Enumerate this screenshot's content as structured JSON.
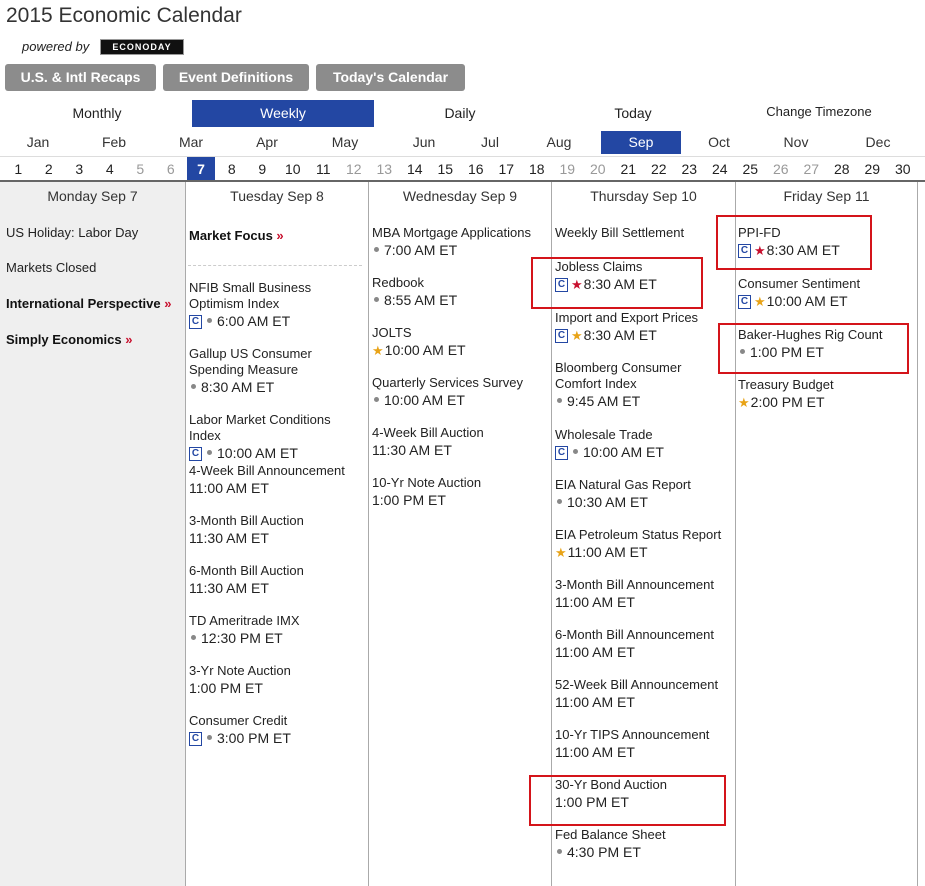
{
  "header": {
    "title": "2015 Economic Calendar",
    "powered_by": "powered by",
    "logo_text": "ECONODAY"
  },
  "top_buttons": [
    "U.S. & Intl Recaps",
    "Event Definitions",
    "Today's Calendar"
  ],
  "view_tabs": [
    {
      "label": "Monthly",
      "active": false
    },
    {
      "label": "Weekly",
      "active": true
    },
    {
      "label": "Daily",
      "active": false
    },
    {
      "label": "Today",
      "active": false
    },
    {
      "label": "Change Timezone",
      "active": false
    }
  ],
  "months": [
    "Jan",
    "Feb",
    "Mar",
    "Apr",
    "May",
    "Jun",
    "Jul",
    "Aug",
    "Sep",
    "Oct",
    "Nov",
    "Dec"
  ],
  "active_month": "Sep",
  "days": [
    "1",
    "2",
    "3",
    "4",
    "5",
    "6",
    "7",
    "8",
    "9",
    "10",
    "11",
    "12",
    "13",
    "14",
    "15",
    "16",
    "17",
    "18",
    "19",
    "20",
    "21",
    "22",
    "23",
    "24",
    "25",
    "26",
    "27",
    "28",
    "29",
    "30"
  ],
  "weekend_days": [
    "5",
    "6",
    "12",
    "13",
    "19",
    "20",
    "26",
    "27"
  ],
  "active_day": "7",
  "colors": {
    "accent": "#2347a3",
    "button_gray": "#8c8c8c",
    "highlight_red": "#d4141a",
    "star_red": "#c8102e",
    "star_gold": "#e8a317"
  },
  "columns": [
    {
      "header": "Monday Sep 7",
      "items": [
        {
          "name": "US Holiday: Labor Day"
        },
        {
          "name": "Markets Closed"
        },
        {
          "name": "International Perspective",
          "link": true
        },
        {
          "name": "Simply Economics",
          "link": true
        }
      ]
    },
    {
      "header": "Tuesday Sep 8",
      "items": [
        {
          "name": "Market Focus",
          "link": true
        },
        {
          "name": "NFIB Small Business Optimism Index",
          "time": "6:00 AM ET",
          "icon": "c-dot"
        },
        {
          "name": "Gallup US Consumer Spending Measure",
          "time": "8:30 AM ET",
          "icon": "dot"
        },
        {
          "name": "Labor Market Conditions Index",
          "time": "10:00 AM ET",
          "icon": "c-dot"
        },
        {
          "name": "4-Week Bill Announcement",
          "time": "11:00 AM ET"
        },
        {
          "name": "3-Month Bill Auction",
          "time": "11:30 AM ET"
        },
        {
          "name": "6-Month Bill Auction",
          "time": "11:30 AM ET"
        },
        {
          "name": "TD Ameritrade IMX",
          "time": "12:30 PM ET",
          "icon": "dot"
        },
        {
          "name": "3-Yr Note Auction",
          "time": "1:00 PM ET"
        },
        {
          "name": "Consumer Credit",
          "time": "3:00 PM ET",
          "icon": "c-dot"
        }
      ]
    },
    {
      "header": "Wednesday Sep 9",
      "items": [
        {
          "name": "MBA Mortgage Applications",
          "time": "7:00 AM ET",
          "icon": "dot"
        },
        {
          "name": "Redbook",
          "time": "8:55 AM ET",
          "icon": "dot"
        },
        {
          "name": "JOLTS",
          "time": "10:00 AM ET",
          "icon": "gold-star"
        },
        {
          "name": "Quarterly Services Survey",
          "time": "10:00 AM ET",
          "icon": "dot"
        },
        {
          "name": "4-Week Bill Auction",
          "time": "11:30 AM ET"
        },
        {
          "name": "10-Yr Note Auction",
          "time": "1:00 PM ET"
        }
      ]
    },
    {
      "header": "Thursday Sep 10",
      "items": [
        {
          "name": "Weekly Bill Settlement"
        },
        {
          "name": "Jobless Claims",
          "time": "8:30 AM ET",
          "icon": "c-red-star"
        },
        {
          "name": "Import and Export Prices",
          "time": "8:30 AM ET",
          "icon": "c-gold-star"
        },
        {
          "name": "Bloomberg Consumer Comfort Index",
          "time": "9:45 AM ET",
          "icon": "dot"
        },
        {
          "name": "Wholesale Trade",
          "time": "10:00 AM ET",
          "icon": "c-dot"
        },
        {
          "name": "EIA Natural Gas Report",
          "time": "10:30 AM ET",
          "icon": "dot"
        },
        {
          "name": "EIA Petroleum Status Report",
          "time": "11:00 AM ET",
          "icon": "gold-star"
        },
        {
          "name": "3-Month Bill Announcement",
          "time": "11:00 AM ET"
        },
        {
          "name": "6-Month Bill Announcement",
          "time": "11:00 AM ET"
        },
        {
          "name": "52-Week Bill Announcement",
          "time": "11:00 AM ET"
        },
        {
          "name": "10-Yr TIPS Announcement",
          "time": "11:00 AM ET"
        },
        {
          "name": "30-Yr Bond Auction",
          "time": "1:00 PM ET"
        },
        {
          "name": "Fed Balance Sheet",
          "time": "4:30 PM ET",
          "icon": "dot"
        }
      ]
    },
    {
      "header": "Friday Sep 11",
      "items": [
        {
          "name": "PPI-FD",
          "time": "8:30 AM ET",
          "icon": "c-red-star"
        },
        {
          "name": "Consumer Sentiment",
          "time": "10:00 AM ET",
          "icon": "c-gold-star"
        },
        {
          "name": "Baker-Hughes Rig Count",
          "time": "1:00 PM ET",
          "icon": "dot"
        },
        {
          "name": "Treasury Budget",
          "time": "2:00 PM ET",
          "icon": "gold-star"
        }
      ]
    }
  ]
}
